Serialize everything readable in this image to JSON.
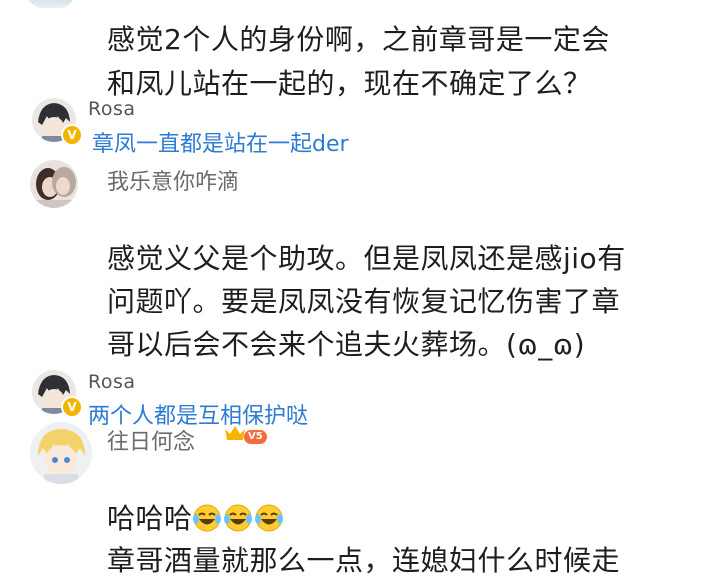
{
  "comments": [
    {
      "lines": [
        "感觉2个人的身份啊，之前章哥是一定会",
        "和凤儿站在一起的，现在不确定了么？"
      ]
    },
    {
      "reply_user": "Rosa",
      "reply_badge": "V",
      "reply_text": "章凤一直都是站在一起der"
    },
    {
      "username": "我乐意你咋滴",
      "lines": [
        "感觉义父是个助攻。但是凤凤还是感jio有",
        "问题吖。要是凤凤没有恢复记忆伤害了章",
        "哥以后会不会来个追夫火葬场。(ɷ_ɷ)"
      ]
    },
    {
      "reply_user": "Rosa",
      "reply_badge": "V",
      "reply_text": "两个人都是互相保护哒"
    },
    {
      "username": "往日何念",
      "level_badge": "V5",
      "first_line": "哈哈哈",
      "emoji": "laugh-cry",
      "emoji_count": 3,
      "second_line": "章哥酒量就那么一点，连媳妇什么时候走"
    }
  ],
  "colors": {
    "reply_text": "#2c7bd6",
    "username": "#6b6b6b",
    "badge_gold": "#f5b400",
    "emoji_yellow": "#ffcc33"
  }
}
